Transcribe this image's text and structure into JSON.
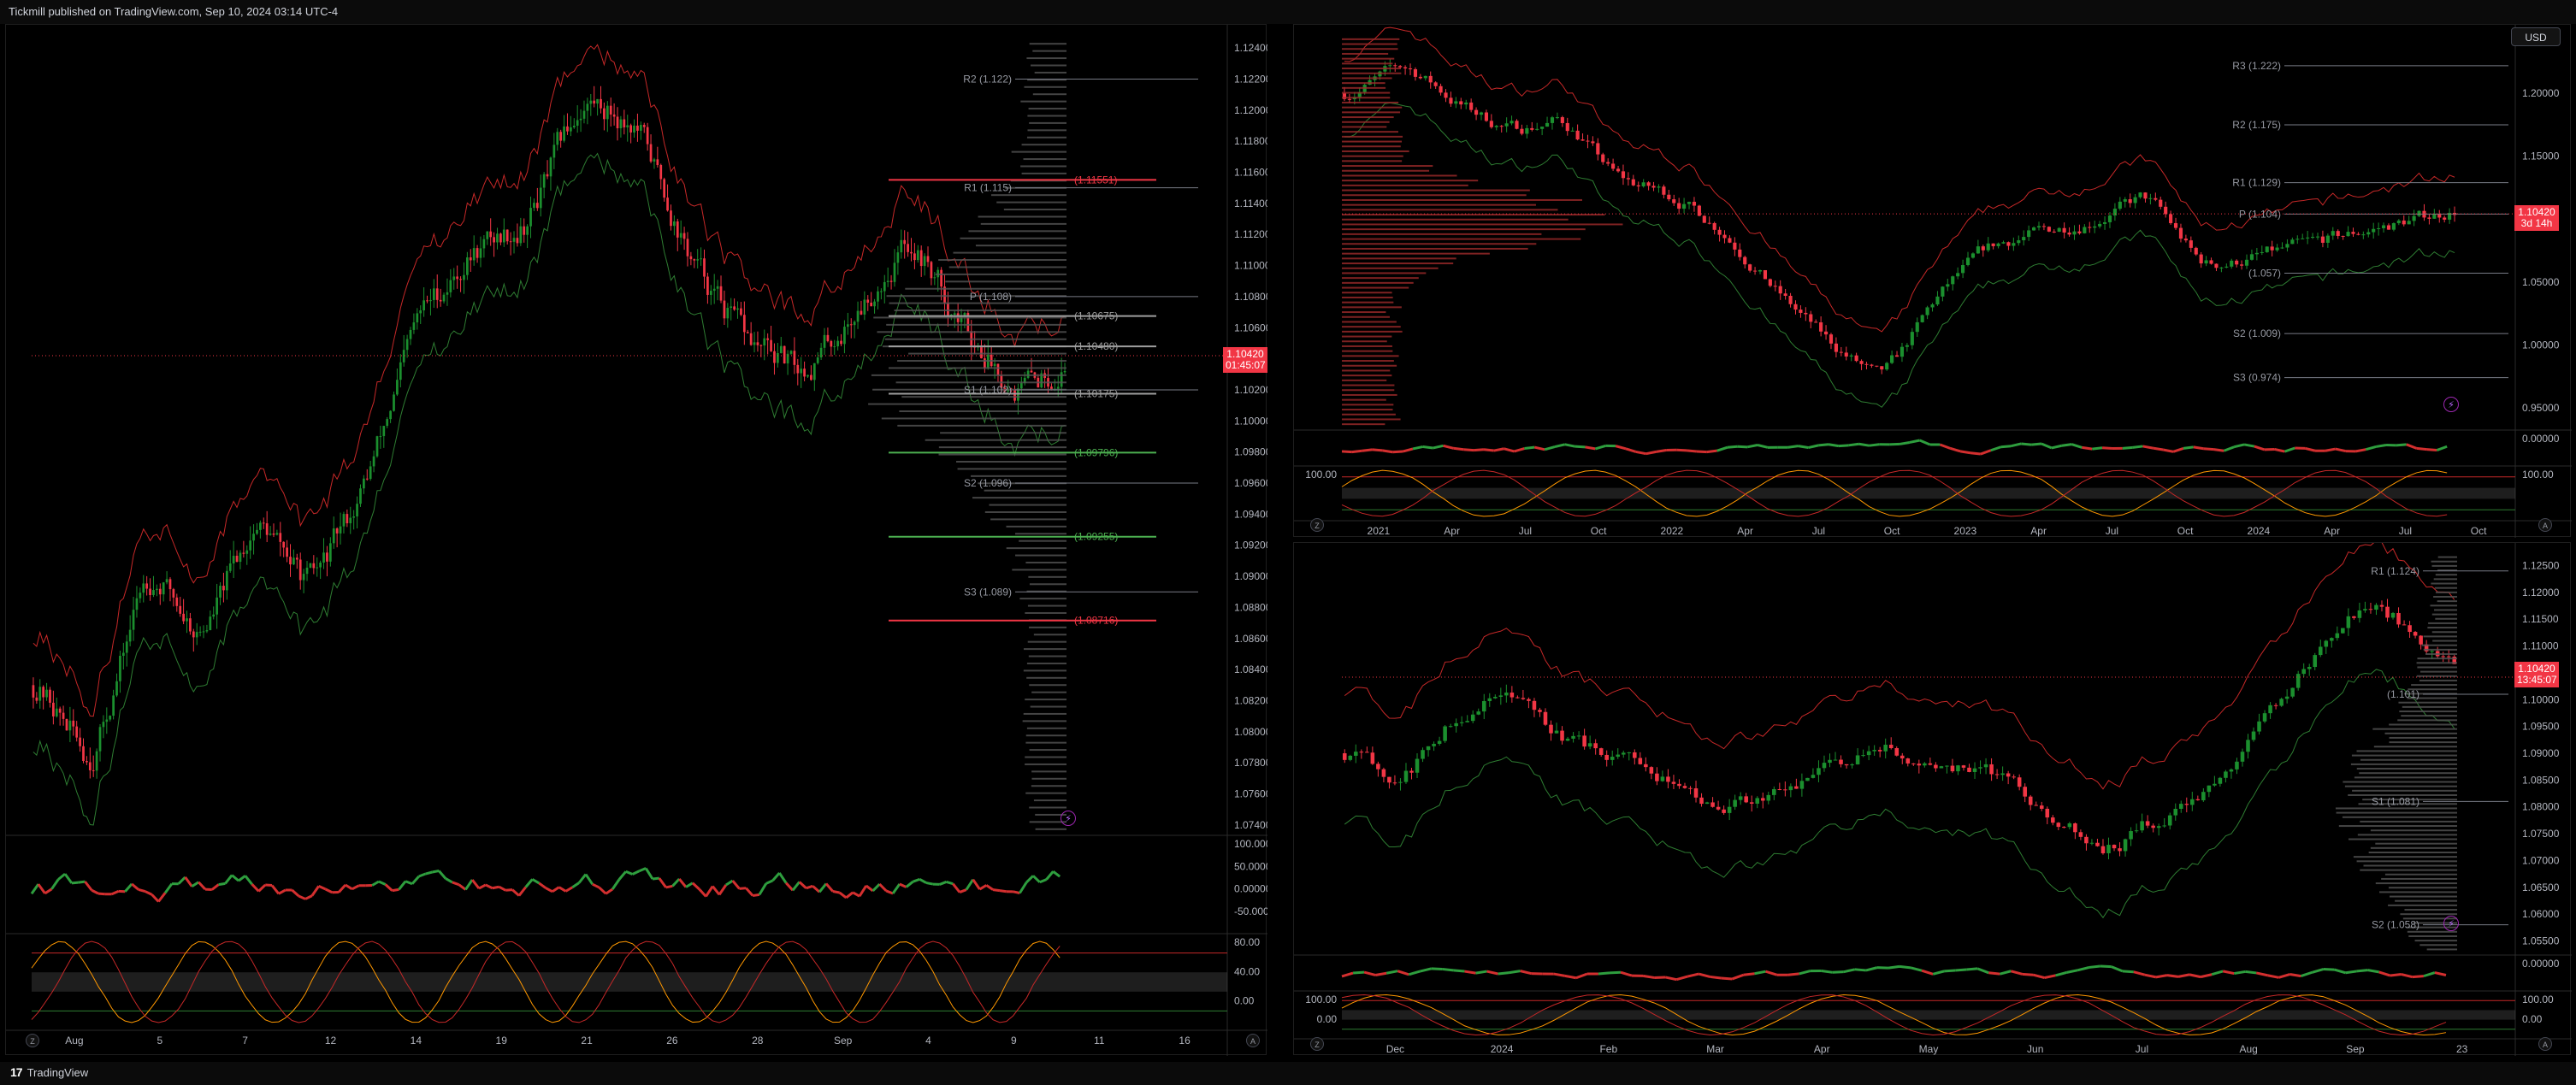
{
  "header": {
    "published": "Tickmill published on TradingView.com, Sep 10, 2024 03:14 UTC-4"
  },
  "footer": {
    "brand_logo": "17",
    "brand_name": "TradingView"
  },
  "currency_button": "USD",
  "colors": {
    "up": "#1b8f2e",
    "down": "#f23645",
    "orange": "#ff9800",
    "green_line": "#2e7d32",
    "red_line": "#c62828",
    "gray_level": "#9e9e9e",
    "bg": "#000000"
  },
  "left_chart": {
    "price_axis": [
      "1.12400",
      "1.12200",
      "1.12000",
      "1.11800",
      "1.11600",
      "1.11400",
      "1.11200",
      "1.11000",
      "1.10800",
      "1.10600",
      "1.10400",
      "1.10200",
      "1.10000",
      "1.09800",
      "1.09600",
      "1.09400",
      "1.09200",
      "1.09000",
      "1.08800",
      "1.08600",
      "1.08400",
      "1.08200",
      "1.08000",
      "1.07800",
      "1.07600",
      "1.07400"
    ],
    "price_range": [
      1.0735,
      1.1245
    ],
    "time_axis": [
      "Aug",
      "5",
      "7",
      "12",
      "14",
      "19",
      "21",
      "26",
      "28",
      "Sep",
      "4",
      "9",
      "11",
      "16"
    ],
    "last_price": "1.10420",
    "countdown": "01:45:07",
    "pivots": [
      {
        "label": "R2 (1.122)",
        "value": 1.122
      },
      {
        "label": "R1 (1.115)",
        "value": 1.115
      },
      {
        "label": "P (1.108)",
        "value": 1.108
      },
      {
        "label": "S1 (1.102)",
        "value": 1.102
      },
      {
        "label": "S2 (1.096)",
        "value": 1.096
      },
      {
        "label": "S3 (1.089)",
        "value": 1.089
      }
    ],
    "fib_levels": [
      {
        "label": "(1.11551)",
        "value": 1.11551,
        "color": "#f23645"
      },
      {
        "label": "(1.10675)",
        "value": 1.10675,
        "color": "#9e9e9e"
      },
      {
        "label": "(1.10480)",
        "value": 1.1048,
        "color": "#9e9e9e"
      },
      {
        "label": "(1.10175)",
        "value": 1.10175,
        "color": "#9e9e9e"
      },
      {
        "label": "(1.09796)",
        "value": 1.09796,
        "color": "#4caf50"
      },
      {
        "label": "(1.09255)",
        "value": 1.09255,
        "color": "#4caf50"
      },
      {
        "label": "(1.08716)",
        "value": 1.08716,
        "color": "#f23645"
      }
    ],
    "osc1_axis": [
      "100.00000",
      "50.00000",
      "0.00000",
      "-50.00000"
    ],
    "osc2_axis": [
      "80.00",
      "40.00",
      "0.00"
    ]
  },
  "right_top_chart": {
    "price_axis": [
      "1.20000",
      "1.15000",
      "1.10000",
      "1.05000",
      "1.00000",
      "0.95000"
    ],
    "price_range": [
      0.935,
      1.245
    ],
    "time_axis": [
      "2021",
      "Apr",
      "Jul",
      "Oct",
      "2022",
      "Apr",
      "Jul",
      "Oct",
      "2023",
      "Apr",
      "Jul",
      "Oct",
      "2024",
      "Apr",
      "Jul",
      "Oct"
    ],
    "last_price": "1.10420",
    "countdown": "3d 14h",
    "pivots": [
      {
        "label": "R3 (1.222)",
        "value": 1.222
      },
      {
        "label": "R2 (1.175)",
        "value": 1.175
      },
      {
        "label": "R1 (1.129)",
        "value": 1.129
      },
      {
        "label": "P (1.104)",
        "value": 1.104
      },
      {
        "label": "(1.057)",
        "value": 1.057
      },
      {
        "label": "S2 (1.009)",
        "value": 1.009
      },
      {
        "label": "S3 (0.974)",
        "value": 0.974
      }
    ],
    "osc1_axis": [
      "0.00000"
    ],
    "osc2_axis": [
      "100.00"
    ]
  },
  "right_bottom_chart": {
    "price_axis": [
      "1.12500",
      "1.12000",
      "1.11500",
      "1.11000",
      "1.10500",
      "1.10000",
      "1.09500",
      "1.09000",
      "1.08500",
      "1.08000",
      "1.07500",
      "1.07000",
      "1.06500",
      "1.06000",
      "1.05500"
    ],
    "price_range": [
      1.053,
      1.127
    ],
    "time_axis": [
      "Dec",
      "2024",
      "Feb",
      "Mar",
      "Apr",
      "May",
      "Jun",
      "Jul",
      "Aug",
      "Sep",
      "23"
    ],
    "last_price": "1.10420",
    "countdown": "13:45:07",
    "pivots": [
      {
        "label": "R1 (1.124)",
        "value": 1.124
      },
      {
        "label": "(1.101)",
        "value": 1.101
      },
      {
        "label": "S1 (1.081)",
        "value": 1.081
      },
      {
        "label": "S2 (1.058)",
        "value": 1.058
      }
    ],
    "osc1_axis": [
      "0.00000"
    ],
    "osc2_axis": [
      "100.00",
      "0.00"
    ]
  }
}
